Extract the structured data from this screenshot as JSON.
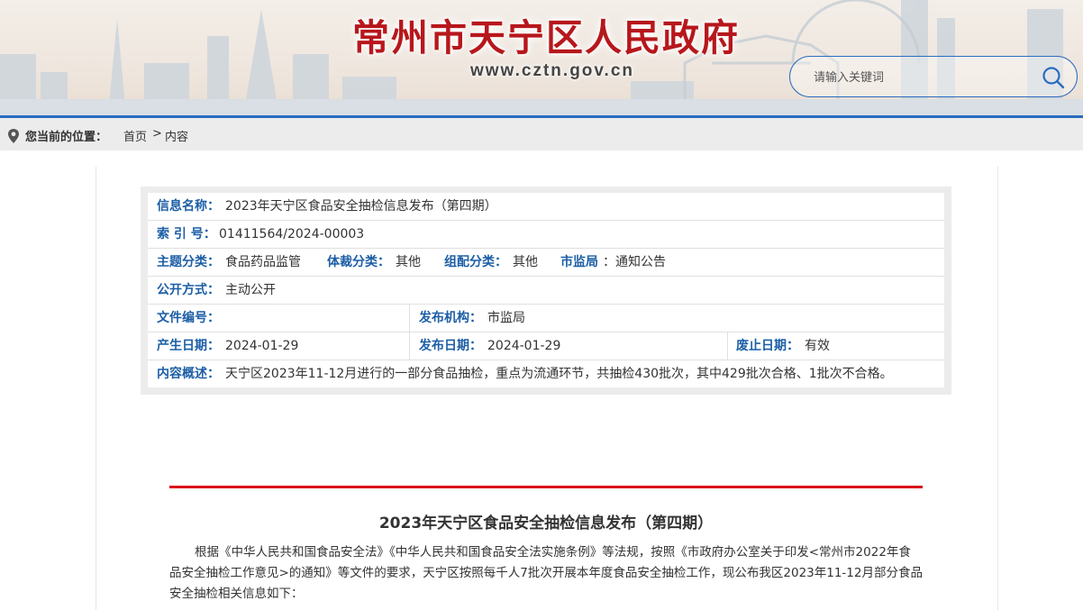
{
  "header": {
    "site_title": "常州市天宁区人民政府",
    "site_url": "www.cztn.gov.cn",
    "search_placeholder": "请输入关键词",
    "search_icon": "search-icon",
    "colors": {
      "title": "#b7171c",
      "accent": "#2a6cc0"
    }
  },
  "breadcrumb": {
    "icon": "location-pin-icon",
    "label": "您当前的位置：",
    "home": "首页",
    "separator": ">",
    "current": "内容"
  },
  "meta": {
    "name_label": "信息名称：",
    "name_value": "2023年天宁区食品安全抽检信息发布（第四期）",
    "index_label": "索 引 号：",
    "index_value": "01411564/2024-00003",
    "topic_label": "主题分类：",
    "topic_value": "食品药品监管",
    "genre_label": "体裁分类：",
    "genre_value": "其他",
    "org_cat_label": "组配分类：",
    "org_cat_value": "其他",
    "bureau_label": "市监局",
    "bureau_value": "：通知公告",
    "open_label": "公开方式：",
    "open_value": "主动公开",
    "docno_label": "文件编号：",
    "docno_value": "",
    "publisher_label": "发布机构：",
    "publisher_value": "市监局",
    "created_label": "产生日期：",
    "created_value": "2024-01-29",
    "published_label": "发布日期：",
    "published_value": "2024-01-29",
    "expiry_label": "废止日期：",
    "expiry_value": "有效",
    "summary_label": "内容概述：",
    "summary_value": "天宁区2023年11-12月进行的一部分食品抽检，重点为流通环节，共抽检430批次，其中429批次合格、1批次不合格。"
  },
  "article": {
    "title": "2023年天宁区食品安全抽检信息发布（第四期）",
    "body": "根据《中华人民共和国食品安全法》《中华人民共和国食品安全法实施条例》等法规，按照《市政府办公室关于印发<常州市2022年食品安全抽检工作意见>的通知》等文件的要求，天宁区按照每千人7批次开展本年度食品安全抽检工作，现公布我区2023年11-12月部分食品安全抽检相关信息如下：",
    "accent_color": "#d8101a"
  }
}
